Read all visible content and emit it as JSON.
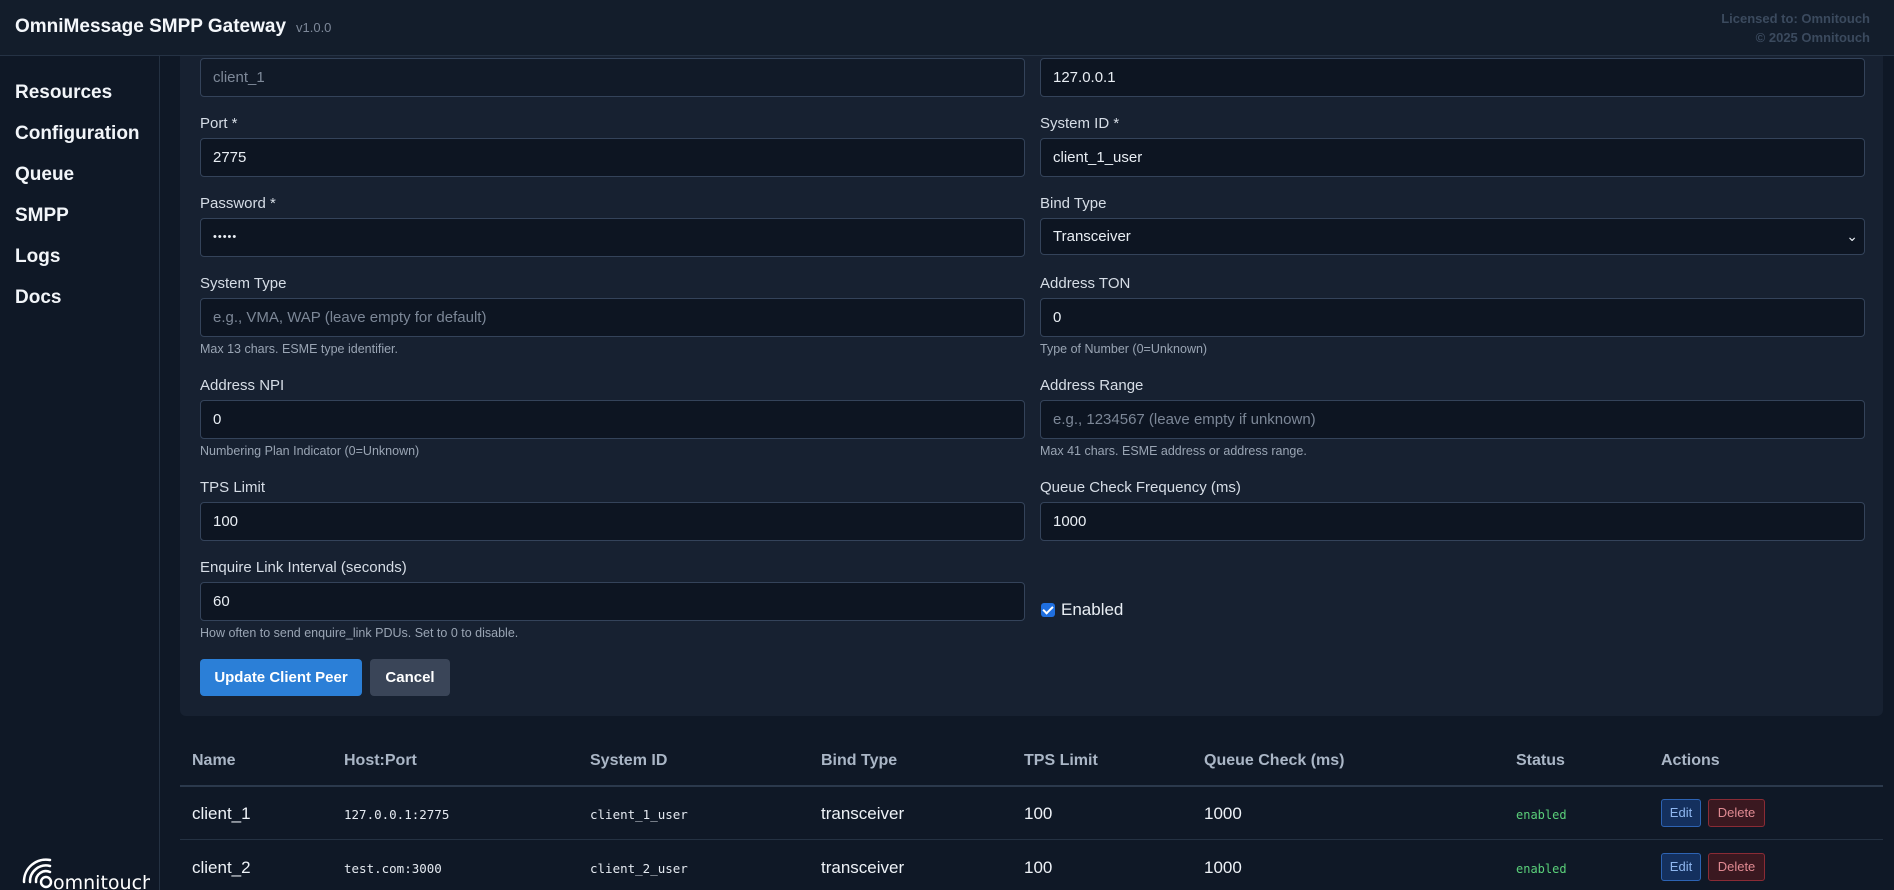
{
  "header": {
    "title": "OmniMessage SMPP Gateway",
    "version": "v1.0.0",
    "license_line1": "Licensed to: Omnitouch",
    "license_line2": "© 2025 Omnitouch"
  },
  "sidebar": {
    "items": [
      {
        "label": "Resources"
      },
      {
        "label": "Configuration"
      },
      {
        "label": "Queue"
      },
      {
        "label": "SMPP"
      },
      {
        "label": "Logs"
      },
      {
        "label": "Docs"
      }
    ],
    "logo_text": "omnitouch"
  },
  "form": {
    "name_value": "client_1",
    "host_value": "127.0.0.1",
    "port_label": "Port *",
    "port_value": "2775",
    "system_id_label": "System ID *",
    "system_id_value": "client_1_user",
    "password_label": "Password *",
    "password_value": "•••••",
    "bind_type_label": "Bind Type",
    "bind_type_value": "Transceiver",
    "system_type_label": "System Type",
    "system_type_placeholder": "e.g., VMA, WAP (leave empty for default)",
    "system_type_hint": "Max 13 chars. ESME type identifier.",
    "address_ton_label": "Address TON",
    "address_ton_value": "0",
    "address_ton_hint": "Type of Number (0=Unknown)",
    "address_npi_label": "Address NPI",
    "address_npi_value": "0",
    "address_npi_hint": "Numbering Plan Indicator (0=Unknown)",
    "address_range_label": "Address Range",
    "address_range_placeholder": "e.g., 1234567 (leave empty if unknown)",
    "address_range_hint": "Max 41 chars. ESME address or address range.",
    "tps_label": "TPS Limit",
    "tps_value": "100",
    "queue_freq_label": "Queue Check Frequency (ms)",
    "queue_freq_value": "1000",
    "enquire_label": "Enquire Link Interval (seconds)",
    "enquire_value": "60",
    "enquire_hint": "How often to send enquire_link PDUs. Set to 0 to disable.",
    "enabled_label": "Enabled",
    "enabled_checked": true,
    "update_button": "Update Client Peer",
    "cancel_button": "Cancel"
  },
  "table": {
    "columns": [
      "Name",
      "Host:Port",
      "System ID",
      "Bind Type",
      "TPS Limit",
      "Queue Check (ms)",
      "Status",
      "Actions"
    ],
    "rows": [
      {
        "name": "client_1",
        "host_port": "127.0.0.1:2775",
        "system_id": "client_1_user",
        "bind_type": "transceiver",
        "tps": "100",
        "queue_check": "1000",
        "status": "enabled",
        "edit": "Edit",
        "delete": "Delete"
      },
      {
        "name": "client_2",
        "host_port": "test.com:3000",
        "system_id": "client_2_user",
        "bind_type": "transceiver",
        "tps": "100",
        "queue_check": "1000",
        "status": "enabled",
        "edit": "Edit",
        "delete": "Delete"
      }
    ]
  },
  "colors": {
    "primary": "#2b7fd7",
    "status_enabled": "#5ad07a",
    "background": "#0f1826"
  }
}
